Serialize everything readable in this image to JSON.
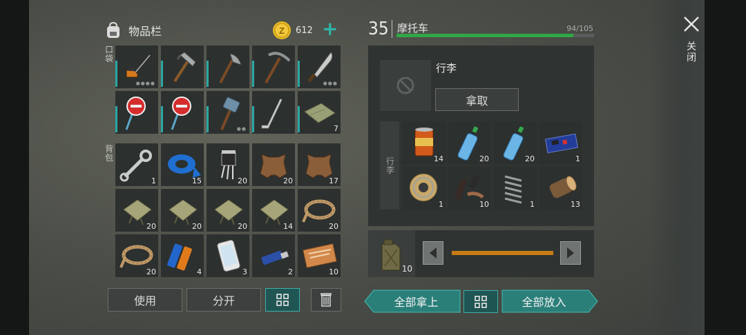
{
  "inventory": {
    "title": "物品栏",
    "coins": "612",
    "add_symbol": "+",
    "pocket_label": "口袋",
    "backpack_label": "背包",
    "pockets": [
      {
        "icon": "chainsaw-icon",
        "count": "",
        "dots": "●●●●"
      },
      {
        "icon": "hammer-icon",
        "count": "",
        "dots": ""
      },
      {
        "icon": "hatchet-icon",
        "count": "",
        "dots": ""
      },
      {
        "icon": "pickaxe-icon",
        "count": "",
        "dots": ""
      },
      {
        "icon": "machete-icon",
        "count": "",
        "dots": "●●●"
      },
      {
        "icon": "stop-sign-icon",
        "count": "",
        "dots": ""
      },
      {
        "icon": "stop-sign-icon",
        "count": "",
        "dots": ""
      },
      {
        "icon": "sledgehammer-icon",
        "count": "",
        "dots": "●●"
      },
      {
        "icon": "golf-club-icon",
        "count": "",
        "dots": ""
      },
      {
        "icon": "cloth-icon",
        "count": "7",
        "dots": ""
      }
    ],
    "backpack": [
      {
        "icon": "wrench-icon",
        "count": "1"
      },
      {
        "icon": "duct-tape-icon",
        "count": "15"
      },
      {
        "icon": "transistor-icon",
        "count": "20"
      },
      {
        "icon": "leather-icon",
        "count": "20"
      },
      {
        "icon": "leather-icon",
        "count": "17"
      },
      {
        "icon": "cloth-bag-icon",
        "count": "20"
      },
      {
        "icon": "cloth-bag-icon",
        "count": "20"
      },
      {
        "icon": "cloth-bag-icon",
        "count": "20"
      },
      {
        "icon": "cloth-bag-icon",
        "count": "14"
      },
      {
        "icon": "rope-icon",
        "count": "20"
      },
      {
        "icon": "rope-icon",
        "count": "20"
      },
      {
        "icon": "battery-icon",
        "count": "4"
      },
      {
        "icon": "phone-icon",
        "count": "3"
      },
      {
        "icon": "usb-drive-icon",
        "count": "2"
      },
      {
        "icon": "coupon-icon",
        "count": "10"
      }
    ],
    "use_label": "使用",
    "split_label": "分开"
  },
  "vehicle": {
    "level": "35",
    "name": "摩托车",
    "durability": "94/105",
    "durability_fraction": 0.895,
    "luggage_title": "行李",
    "take_label": "拿取",
    "luggage_side_label": "行李",
    "items": [
      {
        "icon": "canned-food-icon",
        "count": "14"
      },
      {
        "icon": "water-bottle-icon",
        "count": "20"
      },
      {
        "icon": "water-bottle-icon",
        "count": "20"
      },
      {
        "icon": "circuit-board-icon",
        "count": "1"
      },
      {
        "icon": "wire-spool-icon",
        "count": "1"
      },
      {
        "icon": "gun-parts-icon",
        "count": "10"
      },
      {
        "icon": "spring-icon",
        "count": "1"
      },
      {
        "icon": "log-icon",
        "count": "13"
      }
    ],
    "fuel_count": "10",
    "fuel_fraction": 1.0,
    "take_all_label": "全部拿上",
    "put_all_label": "全部放入"
  },
  "close_label": "关闭",
  "colors": {
    "accent": "#2aa7a3",
    "durability": "#2fa845",
    "fuel": "#c77c14",
    "coin": "#e8b923"
  }
}
